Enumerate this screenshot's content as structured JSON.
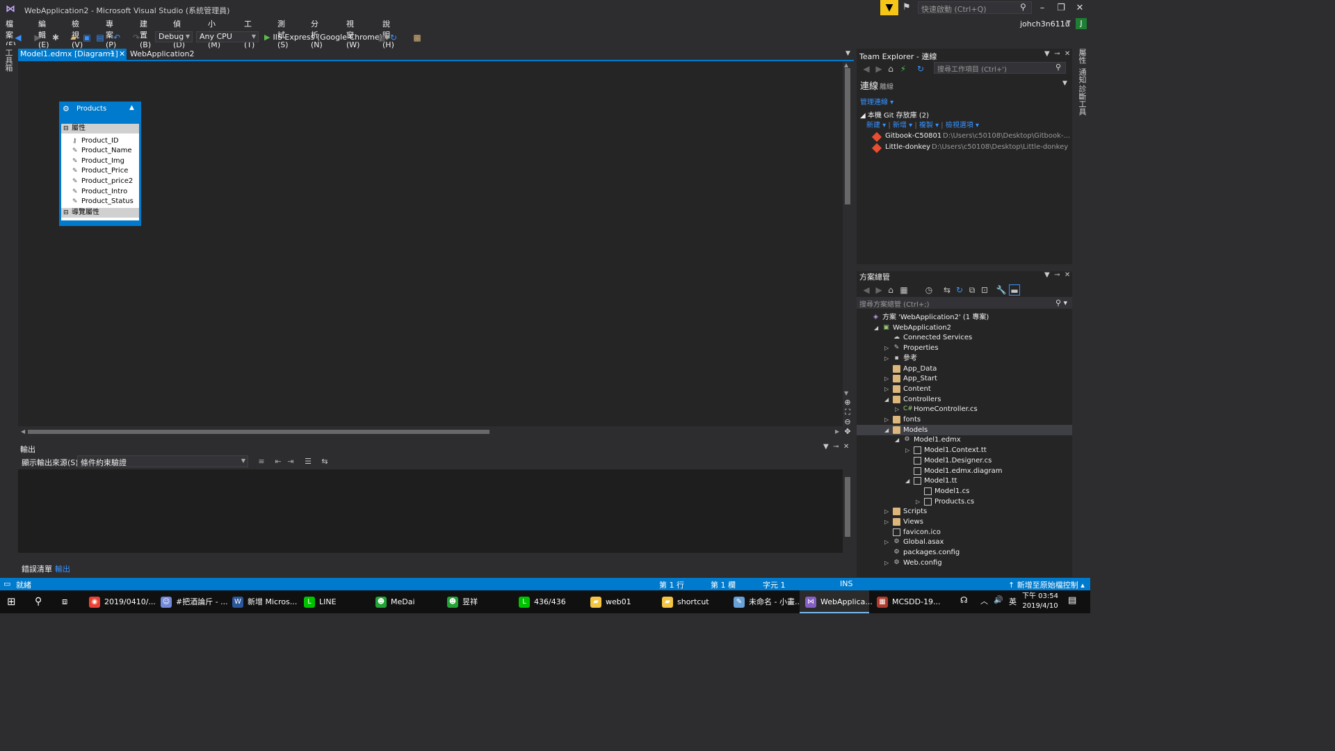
{
  "window": {
    "title": "WebApplication2 - Microsoft Visual Studio (系統管理員)",
    "quick_launch_placeholder": "快速啟動 (Ctrl+Q)",
    "user": "johch3n611u",
    "avatar": "J"
  },
  "menu": [
    "檔案(F)",
    "編輯(E)",
    "檢視(V)",
    "專案(P)",
    "建置(B)",
    "偵錯(D)",
    "小組(M)",
    "工具(T)",
    "測試(S)",
    "分析(N)",
    "視窗(W)",
    "說明(H)"
  ],
  "toolbar": {
    "config": "Debug",
    "platform": "Any CPU",
    "run_label": "IIS Express (Google Chrome)"
  },
  "side_tabs": {
    "left": "工具箱",
    "right": [
      "屬性",
      "通知",
      "診斷工具"
    ]
  },
  "doc_tabs": [
    {
      "label": "Model1.edmx [Diagram1]",
      "active": true
    },
    {
      "label": "WebApplication2",
      "active": false
    }
  ],
  "entity": {
    "name": "Products",
    "properties_header": "屬性",
    "properties": [
      "Product_ID",
      "Product_Name",
      "Product_Img",
      "Product_Price",
      "Product_price2",
      "Product_Intro",
      "Product_Status"
    ],
    "nav_header": "導覽屬性"
  },
  "output": {
    "title": "輸出",
    "source_label": "顯示輸出來源(S):",
    "source_value": "條件約束驗證"
  },
  "bottom_tabs": [
    {
      "label": "錯誤清單",
      "active": false
    },
    {
      "label": "輸出",
      "active": true
    }
  ],
  "team_explorer": {
    "title": "Team Explorer - 連線",
    "search_placeholder": "搜尋工作項目 (Ctrl+')",
    "heading": "連線",
    "heading_sub": "離線",
    "manage": "管理連線",
    "local_repos_title": "本機 Git 存放庫 (2)",
    "actions": [
      "新建",
      "新增",
      "複製",
      "檢視選項"
    ],
    "repos": [
      {
        "name": "Gitbook-C50801",
        "path": "D:\\Users\\c50108\\Desktop\\Gitbook-..."
      },
      {
        "name": "Little-donkey",
        "path": "D:\\Users\\c50108\\Desktop\\Little-donkey"
      }
    ]
  },
  "solution_explorer": {
    "title": "方案總管",
    "search_placeholder": "搜尋方案總管 (Ctrl+;)",
    "tree": [
      {
        "label": "方案 'WebApplication2' (1 專案)",
        "depth": 0,
        "arrow": "",
        "icon": "solution"
      },
      {
        "label": "WebApplication2",
        "depth": 1,
        "arrow": "open",
        "icon": "project"
      },
      {
        "label": "Connected Services",
        "depth": 2,
        "arrow": "",
        "icon": "cloud"
      },
      {
        "label": "Properties",
        "depth": 2,
        "arrow": "closed",
        "icon": "wrench"
      },
      {
        "label": "參考",
        "depth": 2,
        "arrow": "closed",
        "icon": "refs"
      },
      {
        "label": "App_Data",
        "depth": 2,
        "arrow": "",
        "icon": "folder"
      },
      {
        "label": "App_Start",
        "depth": 2,
        "arrow": "closed",
        "icon": "folder"
      },
      {
        "label": "Content",
        "depth": 2,
        "arrow": "closed",
        "icon": "folder"
      },
      {
        "label": "Controllers",
        "depth": 2,
        "arrow": "open",
        "icon": "folder"
      },
      {
        "label": "HomeController.cs",
        "depth": 3,
        "arrow": "closed",
        "icon": "cs"
      },
      {
        "label": "fonts",
        "depth": 2,
        "arrow": "closed",
        "icon": "folder"
      },
      {
        "label": "Models",
        "depth": 2,
        "arrow": "open",
        "icon": "folder",
        "selected": true
      },
      {
        "label": "Model1.edmx",
        "depth": 3,
        "arrow": "open",
        "icon": "edmx"
      },
      {
        "label": "Model1.Context.tt",
        "depth": 4,
        "arrow": "closed",
        "icon": "file"
      },
      {
        "label": "Model1.Designer.cs",
        "depth": 4,
        "arrow": "",
        "icon": "file"
      },
      {
        "label": "Model1.edmx.diagram",
        "depth": 4,
        "arrow": "",
        "icon": "file"
      },
      {
        "label": "Model1.tt",
        "depth": 4,
        "arrow": "open",
        "icon": "file"
      },
      {
        "label": "Model1.cs",
        "depth": 5,
        "arrow": "",
        "icon": "file"
      },
      {
        "label": "Products.cs",
        "depth": 5,
        "arrow": "closed",
        "icon": "file"
      },
      {
        "label": "Scripts",
        "depth": 2,
        "arrow": "closed",
        "icon": "folder"
      },
      {
        "label": "Views",
        "depth": 2,
        "arrow": "closed",
        "icon": "folder"
      },
      {
        "label": "favicon.ico",
        "depth": 2,
        "arrow": "",
        "icon": "file"
      },
      {
        "label": "Global.asax",
        "depth": 2,
        "arrow": "closed",
        "icon": "gear"
      },
      {
        "label": "packages.config",
        "depth": 2,
        "arrow": "",
        "icon": "gear"
      },
      {
        "label": "Web.config",
        "depth": 2,
        "arrow": "closed",
        "icon": "gear"
      }
    ]
  },
  "status": {
    "ready": "就緒",
    "line": "第 1 行",
    "col": "第 1 欄",
    "char": "字元 1",
    "ins": "INS",
    "source_control": "新增至原始檔控制"
  },
  "taskbar": {
    "items": [
      {
        "label": "2019/0410/...",
        "icon": "chrome",
        "color": "#ea4335"
      },
      {
        "label": "#把酒論斤 - ...",
        "icon": "discord",
        "color": "#7289da"
      },
      {
        "label": "新增 Micros...",
        "icon": "word",
        "color": "#2b579a"
      },
      {
        "label": "LINE",
        "icon": "line",
        "color": "#00c300"
      },
      {
        "label": "MeDai",
        "icon": "person",
        "color": "#21a336"
      },
      {
        "label": "昱祥",
        "icon": "person",
        "color": "#21a336"
      },
      {
        "label": "436/436",
        "icon": "line",
        "color": "#00c300"
      },
      {
        "label": "web01",
        "icon": "folder",
        "color": "#f4c542"
      },
      {
        "label": "shortcut",
        "icon": "folder",
        "color": "#f4c542"
      },
      {
        "label": "未命名 - 小畫...",
        "icon": "paint",
        "color": "#6aa0d8"
      },
      {
        "label": "WebApplica...",
        "icon": "vs",
        "color": "#865fc5",
        "active": true
      },
      {
        "label": "MCSDD-19...",
        "icon": "app",
        "color": "#b03a2e"
      }
    ],
    "ime": "英",
    "time": "下午 03:54",
    "date": "2019/4/10"
  },
  "colors": {
    "accent": "#007acc",
    "background": "#2d2d30",
    "editor": "#252526"
  }
}
